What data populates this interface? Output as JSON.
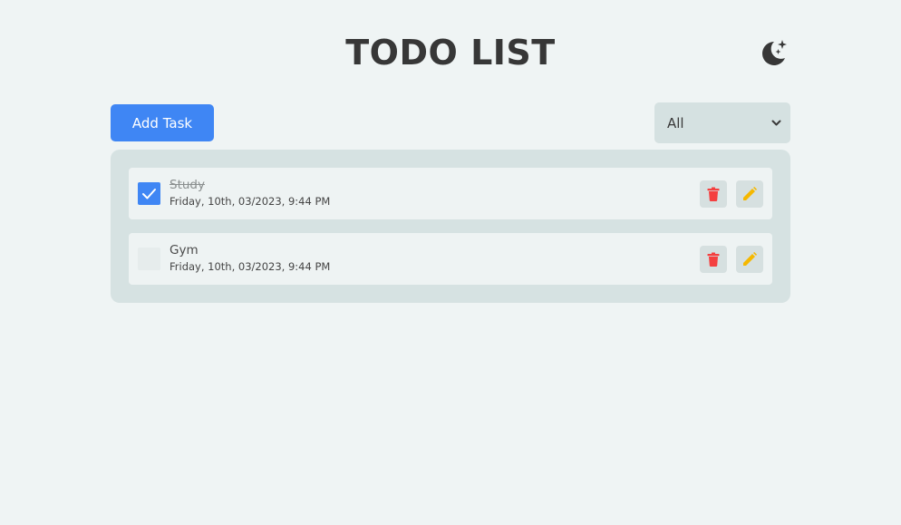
{
  "header": {
    "title": "TODO LIST",
    "theme_icon": "moon-stars-icon"
  },
  "toolbar": {
    "add_label": "Add Task",
    "filter_value": "All"
  },
  "tasks": [
    {
      "name": "Study",
      "time": "Friday, 10th, 03/2023, 9:44 PM",
      "completed": true
    },
    {
      "name": "Gym",
      "time": "Friday, 10th, 03/2023, 9:44 PM",
      "completed": false
    }
  ],
  "icons": {
    "delete": "trash-icon",
    "edit": "pencil-icon",
    "check": "checkmark-icon",
    "dropdown": "chevron-down-icon"
  },
  "colors": {
    "primary": "#3f86f4",
    "delete": "#f44040",
    "edit": "#f5b800",
    "background": "#eff4f4",
    "panel": "#d6e2e2"
  }
}
